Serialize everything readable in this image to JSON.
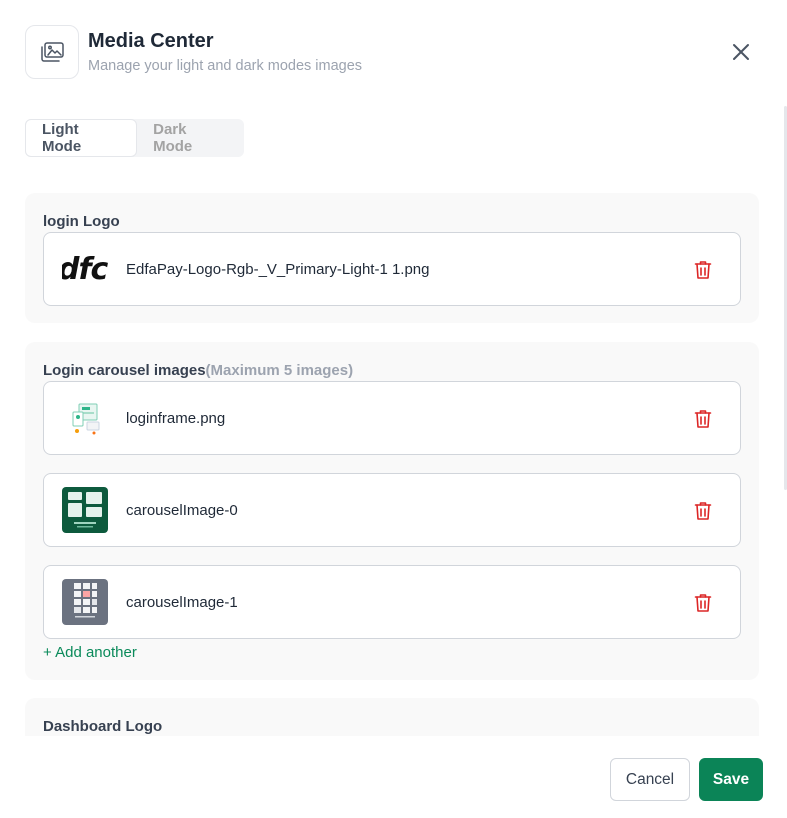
{
  "header": {
    "title": "Media Center",
    "subtitle": "Manage your light and dark modes images",
    "icon": "gallery-icon",
    "close_icon": "close-icon"
  },
  "tabs": [
    {
      "label": "Light Mode",
      "active": true
    },
    {
      "label": "Dark Mode",
      "active": false
    }
  ],
  "login_logo": {
    "label": "login Logo",
    "file": {
      "name": "EdfaPay-Logo-Rgb-_V_Primary-Light-1 1.png",
      "thumb_text": "dfc"
    }
  },
  "carousel": {
    "label": "Login carousel images",
    "hint": "(Maximum 5 images)",
    "files": [
      {
        "name": "loginframe.png"
      },
      {
        "name": "carouselImage-0"
      },
      {
        "name": "carouselImage-1"
      }
    ],
    "add_label": "+ Add another"
  },
  "dashboard_logo": {
    "label": "Dashboard Logo"
  },
  "footer": {
    "cancel_label": "Cancel",
    "save_label": "Save"
  },
  "colors": {
    "primary": "#0b8457",
    "link": "#0a8a5a",
    "danger": "#dc2626",
    "section_bg": "#f9f9f9"
  }
}
